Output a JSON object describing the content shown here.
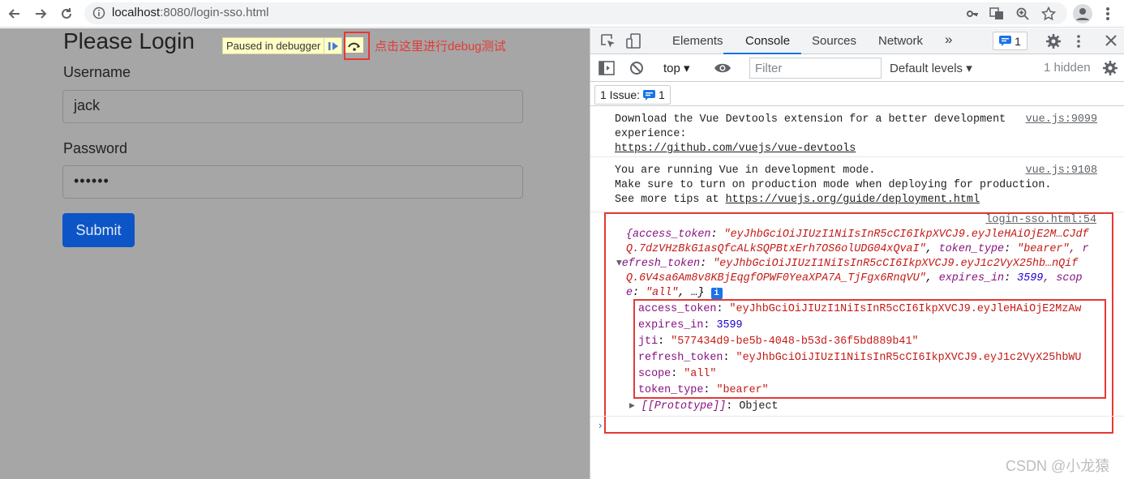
{
  "browser": {
    "url_host": "localhost",
    "url_path": ":8080/login-sso.html"
  },
  "page": {
    "title": "Please Login",
    "debugger_banner": "Paused in debugger",
    "annotation": "点击这里进行debug测试",
    "username_label": "Username",
    "username_value": "jack",
    "password_label": "Password",
    "password_value": "••••••",
    "submit_label": "Submit"
  },
  "devtools": {
    "tabs": [
      "Elements",
      "Console",
      "Sources",
      "Network"
    ],
    "more_tabs": "»",
    "issues_count": "1",
    "context": "top",
    "filter_placeholder": "Filter",
    "levels": "Default levels",
    "hidden": "1 hidden",
    "issue_button": "1 Issue:",
    "issue_count": "1",
    "logs": [
      {
        "lines": [
          "Download the Vue Devtools extension for a better development",
          "experience:"
        ],
        "link": "https://github.com/vuejs/vue-devtools",
        "source": "vue.js:9099"
      },
      {
        "lines": [
          "You are running Vue in development mode.",
          "Make sure to turn on production mode when deploying for production.",
          "See more tips at "
        ],
        "link": "https://vuejs.org/guide/deployment.html",
        "source": "vue.js:9108"
      }
    ],
    "object_log": {
      "source": "login-sso.html:54",
      "preview_line1_key": "{access_token",
      "preview_line1_val": "\"eyJhbGciOiJIUzI1NiIsInR5cCI6IkpXVCJ9.eyJleHAiOjE2M…CJdf",
      "preview_line2_val": "Q.7dzVHzBkG1asQfcALkSQPBtxErh7OS6olUDG04xQvaI\"",
      "preview_line2_key": "token_type",
      "preview_line2_val2": "\"bearer\"",
      "preview_line2_tail": ", r",
      "preview_line3_key": "efresh_token",
      "preview_line3_val": "\"eyJhbGciOiJIUzI1NiIsInR5cCI6IkpXVCJ9.eyJ1c2VyX25hb…nQif",
      "preview_line4_val": "Q.6V4sa6Am8v8KBjEqgfOPWF0YeaXPA7A_TjFgx6RnqVU\"",
      "preview_line4_key": "expires_in",
      "preview_line4_num": "3599",
      "preview_line4_tail": ", scop",
      "preview_line5_key": "e",
      "preview_line5_val": "\"all\"",
      "preview_line5_tail": ", …}",
      "props": [
        {
          "key": "access_token",
          "value": "\"eyJhbGciOiJIUzI1NiIsInR5cCI6IkpXVCJ9.eyJleHAiOjE2MzAw",
          "type": "str"
        },
        {
          "key": "expires_in",
          "value": "3599",
          "type": "num"
        },
        {
          "key": "jti",
          "value": "\"577434d9-be5b-4048-b53d-36f5bd889b41\"",
          "type": "str"
        },
        {
          "key": "refresh_token",
          "value": "\"eyJhbGciOiJIUzI1NiIsInR5cCI6IkpXVCJ9.eyJ1c2VyX25hbWU",
          "type": "str"
        },
        {
          "key": "scope",
          "value": "\"all\"",
          "type": "str"
        },
        {
          "key": "token_type",
          "value": "\"bearer\"",
          "type": "str"
        }
      ],
      "prototype_key": "[[Prototype]]",
      "prototype_val": "Object"
    }
  },
  "watermark": "CSDN @小龙猿"
}
